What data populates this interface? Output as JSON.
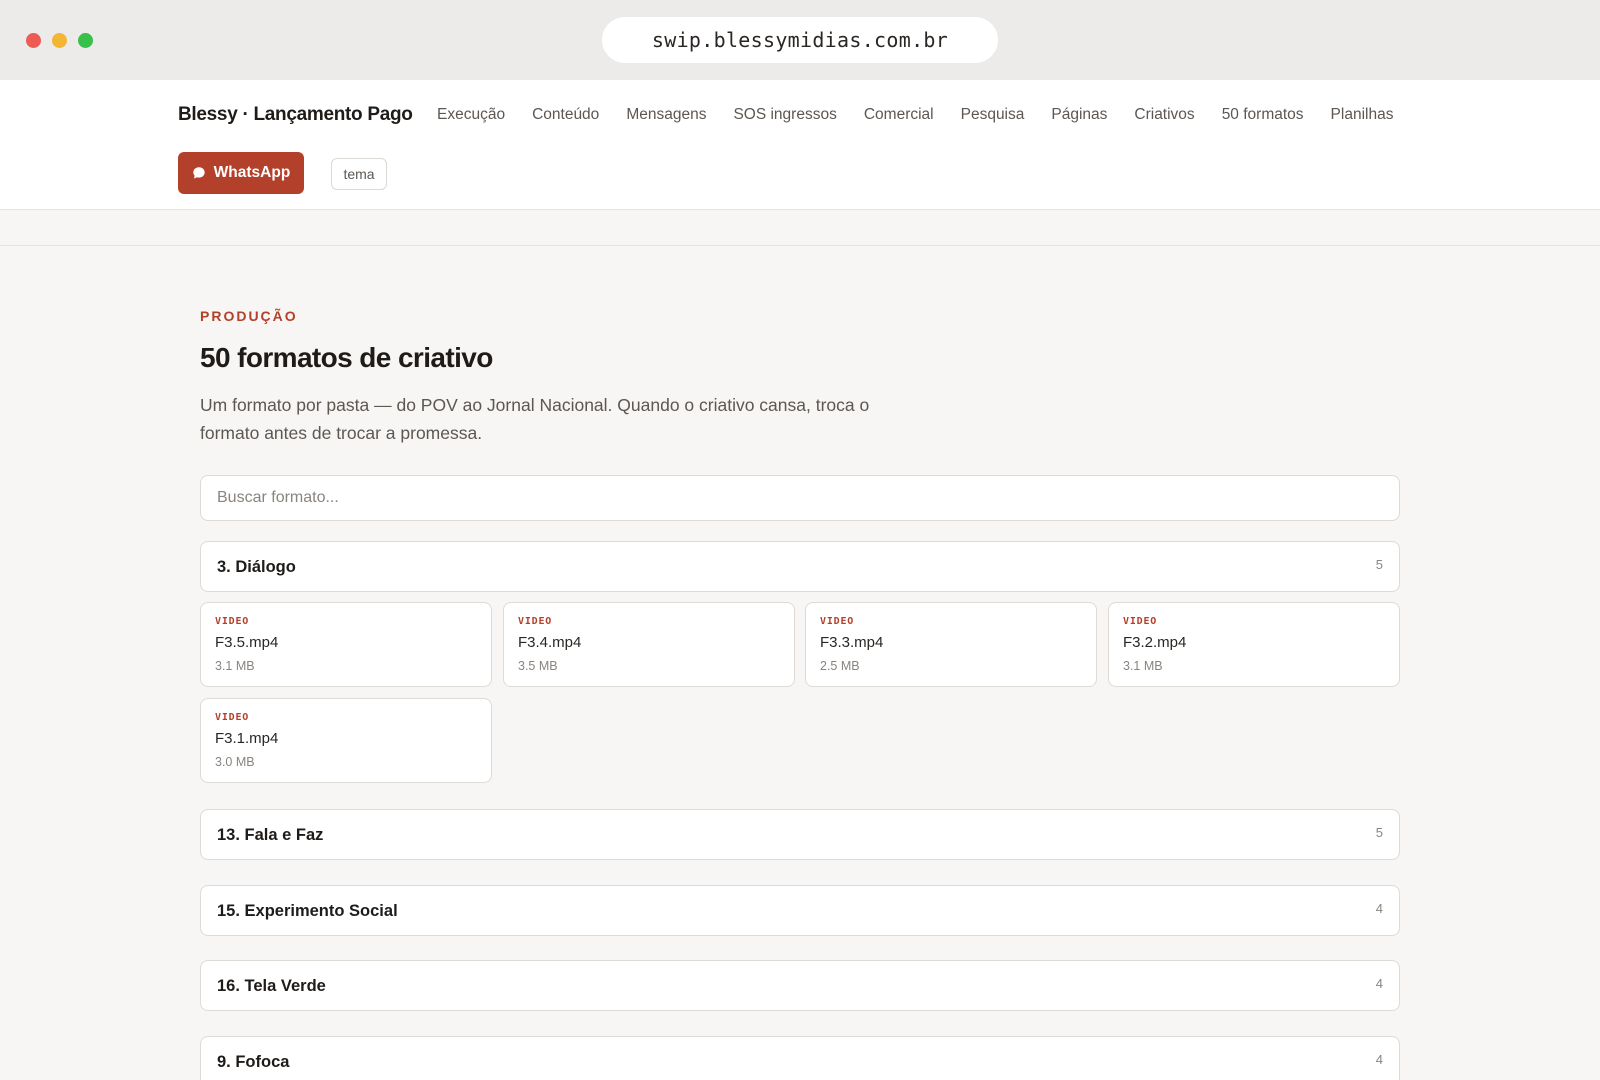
{
  "browser": {
    "url": "swip.blessymidias.com.br"
  },
  "header": {
    "brand": "Blessy · Lançamento Pago",
    "nav": [
      "Execução",
      "Conteúdo",
      "Mensagens",
      "SOS ingressos",
      "Comercial",
      "Pesquisa",
      "Páginas",
      "Criativos",
      "50 formatos",
      "Planilhas"
    ],
    "whatsapp_label": "WhatsApp",
    "theme_label": "tema"
  },
  "page": {
    "eyebrow": "PRODUÇÃO",
    "title": "50 formatos de criativo",
    "description": "Um formato por pasta — do POV ao Jornal Nacional. Quando o criativo cansa, troca o formato antes de trocar a promessa.",
    "search_placeholder": "Buscar formato..."
  },
  "groups": [
    {
      "title": "3. Diálogo",
      "count": "5",
      "files": [
        {
          "type": "VIDEO",
          "name": "F3.5.mp4",
          "size": "3.1 MB"
        },
        {
          "type": "VIDEO",
          "name": "F3.4.mp4",
          "size": "3.5 MB"
        },
        {
          "type": "VIDEO",
          "name": "F3.3.mp4",
          "size": "2.5 MB"
        },
        {
          "type": "VIDEO",
          "name": "F3.2.mp4",
          "size": "3.1 MB"
        },
        {
          "type": "VIDEO",
          "name": "F3.1.mp4",
          "size": "3.0 MB"
        }
      ]
    },
    {
      "title": "13. Fala e Faz",
      "count": "5"
    },
    {
      "title": "15. Experimento Social",
      "count": "4"
    },
    {
      "title": "16. Tela Verde",
      "count": "4"
    },
    {
      "title": "9. Fofoca",
      "count": "4"
    }
  ],
  "colors": {
    "accent": "#b3402a",
    "background": "#f7f6f4",
    "chrome": "#ecebe9"
  },
  "icons": {
    "whatsapp": "chat-bubble-icon"
  }
}
